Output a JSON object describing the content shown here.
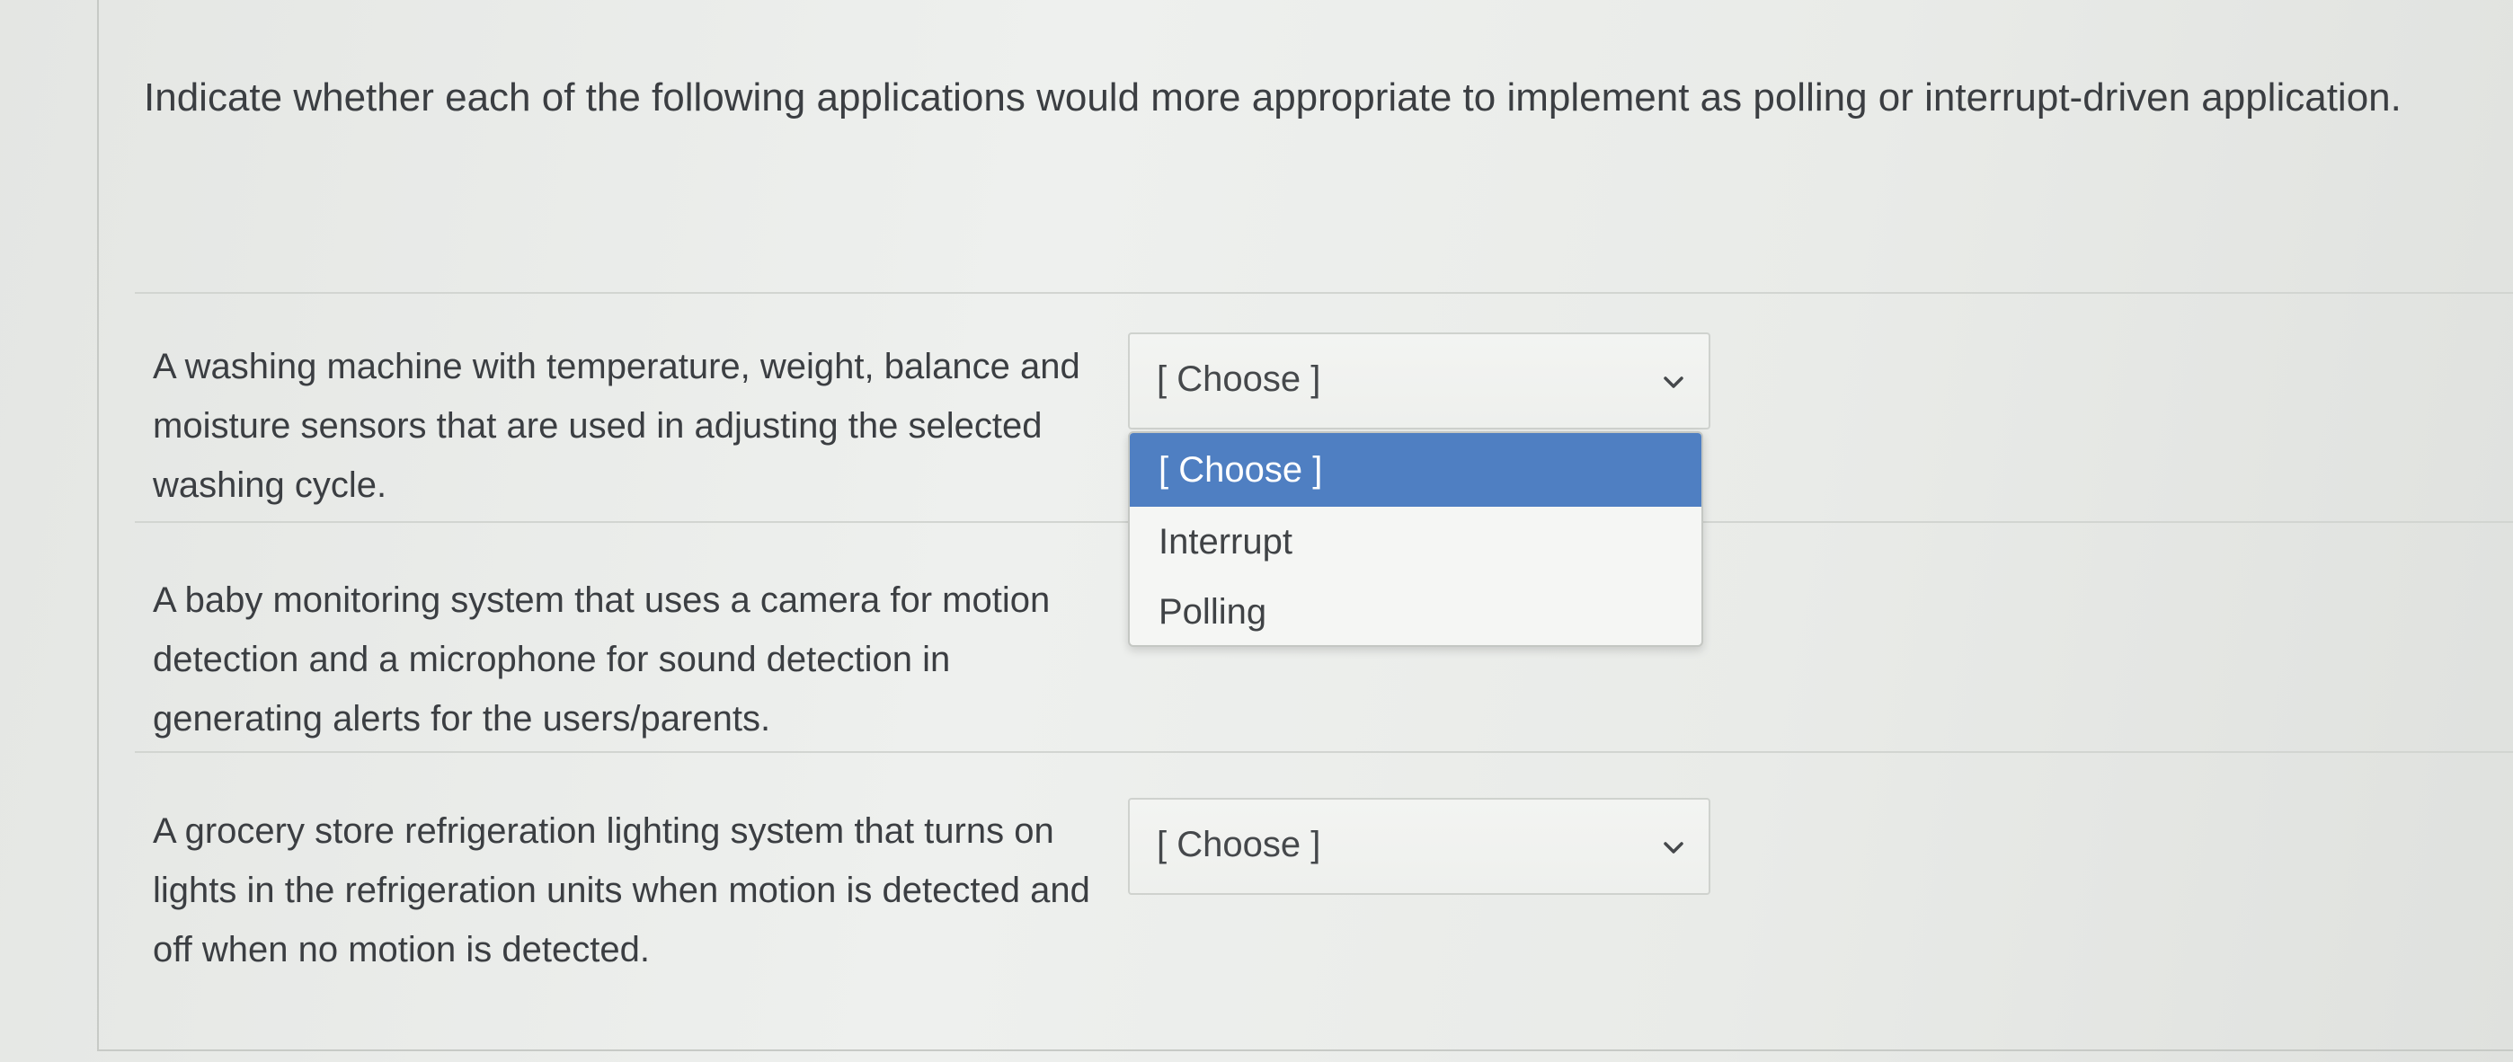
{
  "question": {
    "text": "Indicate whether each of the following applications would more appropriate to implement as polling or interrupt-driven application."
  },
  "rows": [
    {
      "text": "A washing machine with temperature, weight, balance and moisture sensors that are used in adjusting the selected washing cycle.",
      "selected": "[ Choose ]"
    },
    {
      "text": "A baby monitoring system that uses a camera for motion detection and a microphone for sound detection in generating alerts for the users/parents.",
      "selected": "[ Choose ]"
    },
    {
      "text": "A grocery store refrigeration lighting system that turns on lights in the refrigeration units when motion is detected and off when no motion is detected.",
      "selected": "[ Choose ]"
    }
  ],
  "dropdown": {
    "options": [
      "[ Choose ]",
      "Interrupt",
      "Polling"
    ],
    "highlighted": "[ Choose ]"
  },
  "colors": {
    "highlight": "#4f7fc2",
    "border": "#cfd2ce",
    "text": "#3b3e42"
  },
  "icons": {
    "select_chevron": "chevron-down-icon"
  }
}
